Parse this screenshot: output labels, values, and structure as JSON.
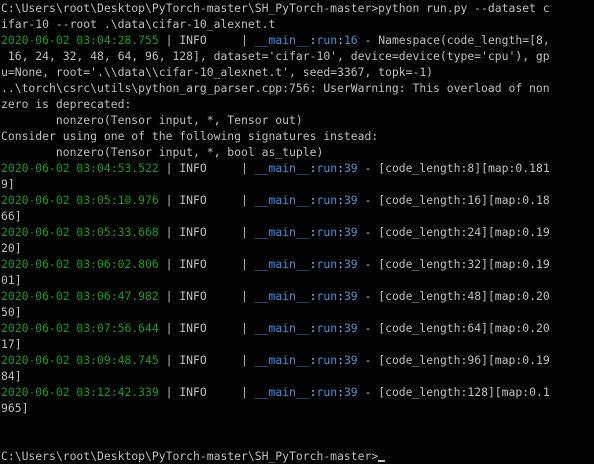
{
  "console": {
    "prompt_command_line1": "C:\\Users\\root\\Desktop\\PyTorch-master\\SH_PyTorch-master>python run.py --dataset c",
    "prompt_command_line2": "ifar-10 --root .\\data\\cifar-10_alexnet.t",
    "ns_log": {
      "timestamp": "2020-06-02 03:04:28.755",
      "sep1": " | ",
      "level": "INFO",
      "sep2": "     | ",
      "module": "__main__",
      "colon": ":",
      "func": "run",
      "line_no": "16",
      "msg": " - Namespace(code_length=[8,"
    },
    "ns_cont1": " 16, 24, 32, 48, 64, 96, 128], dataset='cifar-10', device=device(type='cpu'), gp",
    "ns_cont2": "u=None, root='.\\\\data\\\\cifar-10_alexnet.t', seed=3367, topk=-1)",
    "warning_line1": "..\\torch\\csrc\\utils\\python_arg_parser.cpp:756: UserWarning: This overload of non",
    "warning_line2": "zero is deprecated:",
    "warning_line3": "        nonzero(Tensor input, *, Tensor out)",
    "warning_line4": "Consider using one of the following signatures instead:",
    "warning_line5": "        nonzero(Tensor input, *, bool as_tuple)",
    "results": [
      {
        "timestamp": "2020-06-02 03:04:53.522",
        "sep1": " | ",
        "level": "INFO",
        "sep2": "     | ",
        "module": "__main__",
        "colon": ":",
        "func": "run",
        "line_no": "39",
        "msg": " - [code_length:8][map:0.181",
        "wrap": "9]"
      },
      {
        "timestamp": "2020-06-02 03:05:10.976",
        "sep1": " | ",
        "level": "INFO",
        "sep2": "     | ",
        "module": "__main__",
        "colon": ":",
        "func": "run",
        "line_no": "39",
        "msg": " - [code_length:16][map:0.18",
        "wrap": "66]"
      },
      {
        "timestamp": "2020-06-02 03:05:33.668",
        "sep1": " | ",
        "level": "INFO",
        "sep2": "     | ",
        "module": "__main__",
        "colon": ":",
        "func": "run",
        "line_no": "39",
        "msg": " - [code_length:24][map:0.19",
        "wrap": "20]"
      },
      {
        "timestamp": "2020-06-02 03:06:02.806",
        "sep1": " | ",
        "level": "INFO",
        "sep2": "     | ",
        "module": "__main__",
        "colon": ":",
        "func": "run",
        "line_no": "39",
        "msg": " - [code_length:32][map:0.19",
        "wrap": "01]"
      },
      {
        "timestamp": "2020-06-02 03:06:47.982",
        "sep1": " | ",
        "level": "INFO",
        "sep2": "     | ",
        "module": "__main__",
        "colon": ":",
        "func": "run",
        "line_no": "39",
        "msg": " - [code_length:48][map:0.20",
        "wrap": "50]"
      },
      {
        "timestamp": "2020-06-02 03:07:56.644",
        "sep1": " | ",
        "level": "INFO",
        "sep2": "     | ",
        "module": "__main__",
        "colon": ":",
        "func": "run",
        "line_no": "39",
        "msg": " - [code_length:64][map:0.20",
        "wrap": "17]"
      },
      {
        "timestamp": "2020-06-02 03:09:48.745",
        "sep1": " | ",
        "level": "INFO",
        "sep2": "     | ",
        "module": "__main__",
        "colon": ":",
        "func": "run",
        "line_no": "39",
        "msg": " - [code_length:96][map:0.19",
        "wrap": "84]"
      },
      {
        "timestamp": "2020-06-02 03:12:42.339",
        "sep1": " | ",
        "level": "INFO",
        "sep2": "     | ",
        "module": "__main__",
        "colon": ":",
        "func": "run",
        "line_no": "39",
        "msg": " - [code_length:128][map:0.1",
        "wrap": "965]"
      }
    ],
    "final_prompt": "C:\\Users\\root\\Desktop\\PyTorch-master\\SH_PyTorch-master>",
    "colors": {
      "background": "#000000",
      "text": "#c0c0c0",
      "timestamp": "#13a10e",
      "module": "#3a96dd"
    }
  }
}
